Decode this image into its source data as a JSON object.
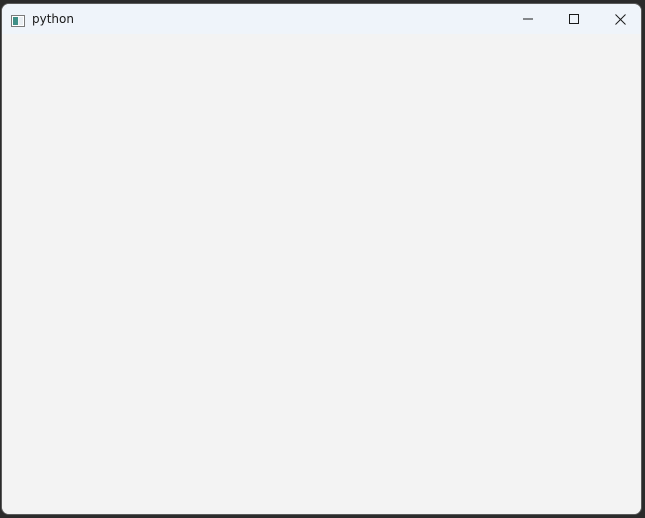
{
  "window": {
    "title": "python",
    "icon": "app-window-icon",
    "controls": {
      "minimize_icon": "minimize-icon",
      "maximize_icon": "maximize-icon",
      "close_icon": "close-icon"
    }
  },
  "colors": {
    "titlebar": "#eff4fa",
    "client": "#f3f3f3",
    "frame": "#2b2b2b"
  }
}
